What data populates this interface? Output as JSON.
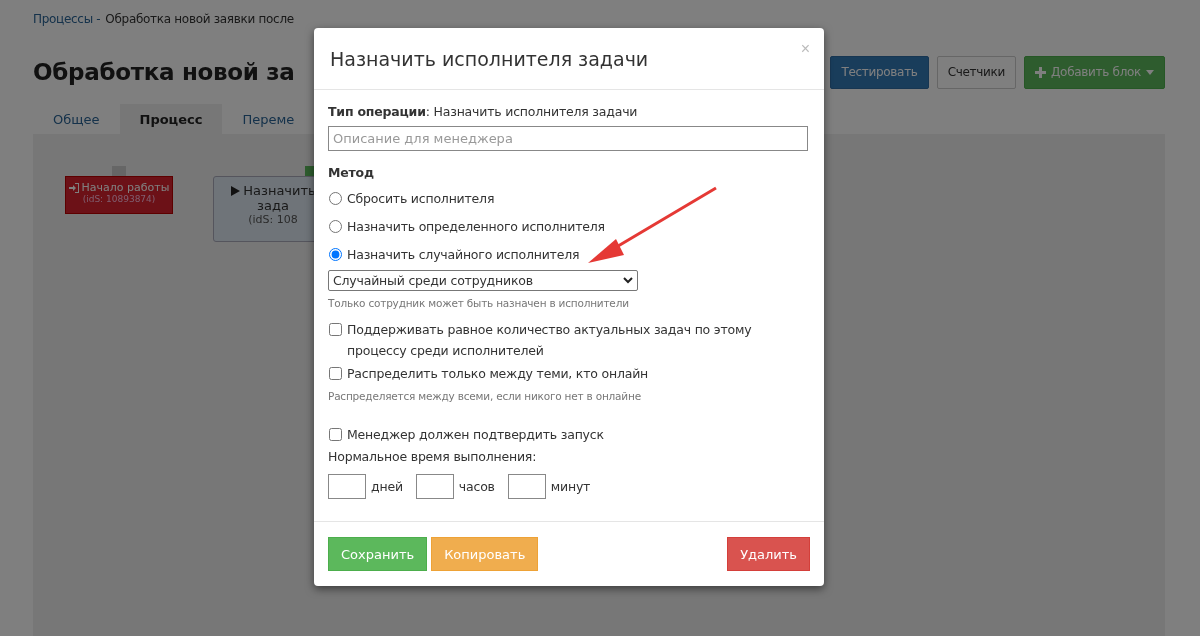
{
  "breadcrumb": {
    "link": "Процессы -",
    "current": "Обработка новой заявки после"
  },
  "page_title": "Обработка новой за",
  "toolbar": [
    "Тестировать",
    "Счетчики",
    "Добавить блок"
  ],
  "tabs": [
    {
      "label": "Общее",
      "selected": false
    },
    {
      "label": "Процесс",
      "selected": true
    },
    {
      "label": "Переме",
      "selected": false
    }
  ],
  "nodes": [
    {
      "kind": "start",
      "title": "Начало работы",
      "ids": "(idS: 10893874)"
    },
    {
      "kind": "action",
      "title": "Назначить",
      "line2": "зада",
      "ids": "(idS: 108"
    }
  ],
  "dialog": {
    "title": "Назначить исполнителя задачи",
    "close": "×",
    "operation_label": "Тип операции",
    "operation_value": ": Назначить исполнителя задачи",
    "description": {
      "placeholder": "Описание для менеджера"
    },
    "method_label": "Метод",
    "methods": [
      {
        "label": "Сбросить исполнителя",
        "selected": false
      },
      {
        "label": "Назначить определенного исполнителя",
        "selected": false
      },
      {
        "label": "Назначить случайного исполнителя",
        "selected": true
      }
    ],
    "random_select": "Случайный среди сотрудников",
    "random_hint": "Только сотрудник может быть назначен в исполнители",
    "options": [
      {
        "label": "Поддерживать равное количество актуальных задач по этому процессу среди исполнителей",
        "checked": false
      },
      {
        "label": "Распределить только между теми, кто онлайн",
        "checked": false,
        "hint": "Распределяется между всеми, если никого нет в онлайне"
      },
      {
        "label": "Менеджер должен подтвердить запуск",
        "checked": false
      }
    ],
    "time_label": "Нормальное время выполнения:",
    "time_units": [
      "дней",
      "часов",
      "минут"
    ],
    "buttons": [
      {
        "kind": "save",
        "label": "Сохранить"
      },
      {
        "kind": "copy",
        "label": "Копировать"
      },
      {
        "kind": "delete",
        "label": "Удалить"
      }
    ]
  }
}
